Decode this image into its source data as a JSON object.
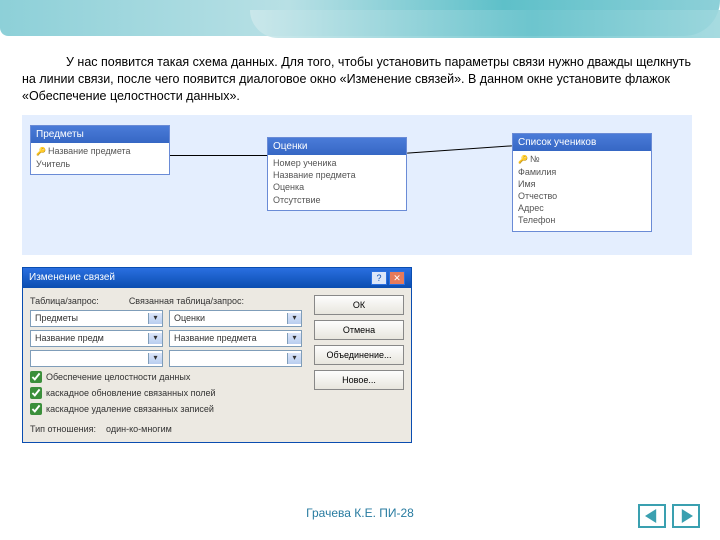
{
  "paragraph": "У нас появится такая схема данных. Для того, чтобы установить параметры связи нужно дважды щелкнуть на линии связи, после чего появится диалоговое окно «Изменение связей». В данном окне установите флажок «Обеспечение целостности данных».",
  "schema": {
    "table1": {
      "title": "Предметы",
      "pk": "Название предмета",
      "f1": "Учитель"
    },
    "table2": {
      "title": "Оценки",
      "f0": "Номер ученика",
      "f1": "Название предмета",
      "f2": "Оценка",
      "f3": "Отсутствие"
    },
    "table3": {
      "title": "Список учеников",
      "pk": "№",
      "f1": "Фамилия",
      "f2": "Имя",
      "f3": "Отчество",
      "f4": "Адрес",
      "f5": "Телефон"
    }
  },
  "dialog": {
    "title": "Изменение связей",
    "labels": {
      "left": "Таблица/запрос:",
      "right": "Связанная таблица/запрос:"
    },
    "combo1": "Предметы",
    "combo2": "Оценки",
    "combo3": "Название предм",
    "combo4": "Название предмета",
    "chk1": "Обеспечение целостности данных",
    "chk2": "каскадное обновление связанных полей",
    "chk3": "каскадное удаление связанных записей",
    "rel_label": "Тип отношения:",
    "rel_value": "один-ко-многим",
    "buttons": {
      "ok": "ОК",
      "cancel": "Отмена",
      "join": "Объединение...",
      "new": "Новое..."
    }
  },
  "footer": "Грачева К.Е. ПИ-28"
}
